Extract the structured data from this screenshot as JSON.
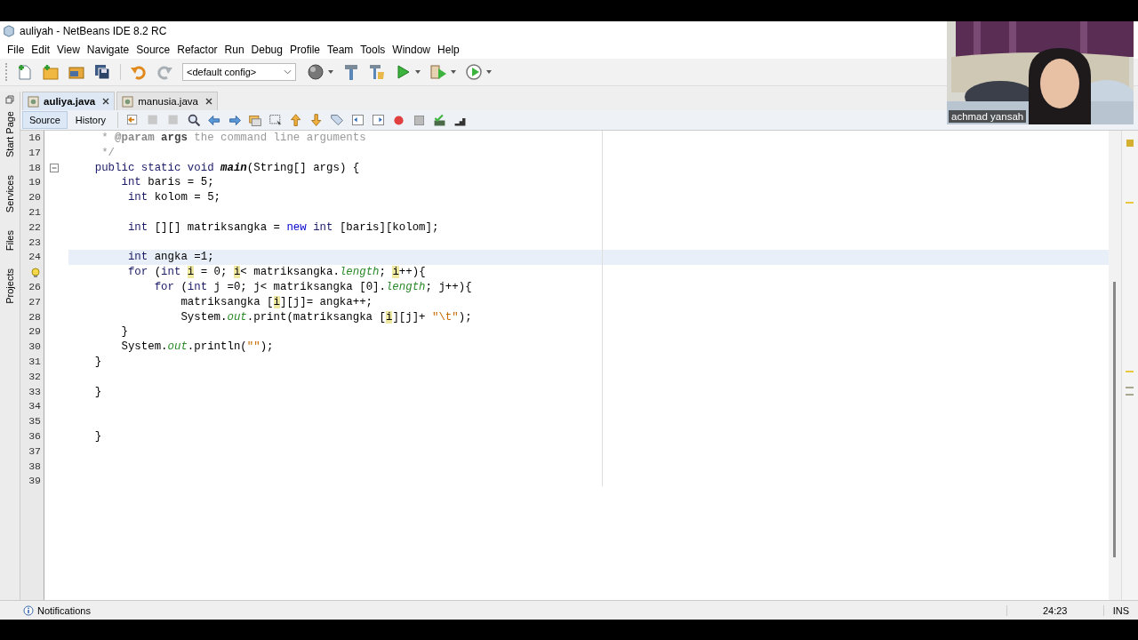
{
  "window": {
    "title": "auliyah - NetBeans IDE 8.2 RC"
  },
  "menu": [
    "File",
    "Edit",
    "View",
    "Navigate",
    "Source",
    "Refactor",
    "Run",
    "Debug",
    "Profile",
    "Team",
    "Tools",
    "Window",
    "Help"
  ],
  "toolbar": {
    "config": "<default config>"
  },
  "side_tabs": [
    "Start Page",
    "Services",
    "Files",
    "Projects"
  ],
  "tabs": [
    {
      "label": "auliya.java",
      "selected": true
    },
    {
      "label": "manusia.java",
      "selected": false
    }
  ],
  "view_tabs": [
    {
      "label": "Source",
      "selected": true
    },
    {
      "label": "History",
      "selected": false
    }
  ],
  "code": [
    {
      "number": "16",
      "current": false,
      "hint": false,
      "fold": false,
      "segments": [
        {
          "kind": "comment",
          "text": "     * "
        },
        {
          "kind": "comment-tag",
          "text": "@param"
        },
        {
          "kind": "comment-bold",
          "text": " args"
        },
        {
          "kind": "comment",
          "text": " the command line arguments"
        }
      ]
    },
    {
      "number": "17",
      "current": false,
      "hint": false,
      "fold": false,
      "segments": [
        {
          "kind": "comment",
          "text": "     */"
        }
      ]
    },
    {
      "number": "18",
      "current": false,
      "hint": false,
      "fold": true,
      "segments": [
        {
          "kind": "keyword",
          "text": "    public static void "
        },
        {
          "kind": "method",
          "text": "main"
        },
        {
          "kind": "plain",
          "text": "(String[] args) {"
        }
      ]
    },
    {
      "number": "19",
      "current": false,
      "hint": false,
      "fold": false,
      "segments": [
        {
          "kind": "keyword",
          "text": "        int"
        },
        {
          "kind": "plain",
          "text": " baris = 5;"
        }
      ]
    },
    {
      "number": "20",
      "current": false,
      "hint": false,
      "fold": false,
      "segments": [
        {
          "kind": "keyword",
          "text": "         int"
        },
        {
          "kind": "plain",
          "text": " kolom = 5;"
        }
      ]
    },
    {
      "number": "21",
      "current": false,
      "hint": false,
      "fold": false
    },
    {
      "number": "22",
      "current": false,
      "hint": false,
      "fold": false,
      "segments": [
        {
          "kind": "keyword",
          "text": "         int"
        },
        {
          "kind": "plain",
          "text": " [][] matriksangka = "
        },
        {
          "kind": "keyword-new",
          "text": "new "
        },
        {
          "kind": "keyword",
          "text": "int"
        },
        {
          "kind": "plain",
          "text": " [baris][kolom];"
        }
      ]
    },
    {
      "number": "23",
      "current": false,
      "hint": false,
      "fold": false
    },
    {
      "number": "24",
      "current": true,
      "hint": false,
      "fold": false,
      "segments": [
        {
          "kind": "keyword",
          "text": "         int"
        },
        {
          "kind": "plain",
          "text": " angka =1;"
        }
      ]
    },
    {
      "current": false,
      "hint": true,
      "fold": false,
      "segments": [
        {
          "kind": "keyword",
          "text": "         for"
        },
        {
          "kind": "plain",
          "text": " ("
        },
        {
          "kind": "keyword",
          "text": "int "
        },
        {
          "kind": "mark",
          "text": "i"
        },
        {
          "kind": "plain",
          "text": " = 0; "
        },
        {
          "kind": "mark",
          "text": "i"
        },
        {
          "kind": "plain",
          "text": "< matriksangka."
        },
        {
          "kind": "field",
          "text": "length"
        },
        {
          "kind": "plain",
          "text": "; "
        },
        {
          "kind": "mark",
          "text": "i"
        },
        {
          "kind": "plain",
          "text": "++){"
        }
      ]
    },
    {
      "number": "26",
      "current": false,
      "hint": false,
      "fold": false,
      "segments": [
        {
          "kind": "keyword",
          "text": "             for"
        },
        {
          "kind": "plain",
          "text": " ("
        },
        {
          "kind": "keyword",
          "text": "int"
        },
        {
          "kind": "plain",
          "text": " j =0; j< matriksangka [0]."
        },
        {
          "kind": "field",
          "text": "length"
        },
        {
          "kind": "plain",
          "text": "; j++){"
        }
      ]
    },
    {
      "number": "27",
      "current": false,
      "hint": false,
      "fold": false,
      "segments": [
        {
          "kind": "plain",
          "text": "                 matriksangka ["
        },
        {
          "kind": "mark",
          "text": "i"
        },
        {
          "kind": "plain",
          "text": "][j]= angka++;"
        }
      ]
    },
    {
      "number": "28",
      "current": false,
      "hint": false,
      "fold": false,
      "segments": [
        {
          "kind": "plain",
          "text": "                 System."
        },
        {
          "kind": "field",
          "text": "out"
        },
        {
          "kind": "plain",
          "text": ".print(matriksangka ["
        },
        {
          "kind": "mark",
          "text": "i"
        },
        {
          "kind": "plain",
          "text": "][j]+ "
        },
        {
          "kind": "string",
          "text": "\"\\t\""
        },
        {
          "kind": "plain",
          "text": ");"
        }
      ]
    },
    {
      "number": "29",
      "current": false,
      "hint": false,
      "fold": false,
      "segments": [
        {
          "kind": "plain",
          "text": "        }"
        }
      ]
    },
    {
      "number": "30",
      "current": false,
      "hint": false,
      "fold": false,
      "segments": [
        {
          "kind": "plain",
          "text": "        System."
        },
        {
          "kind": "field",
          "text": "out"
        },
        {
          "kind": "plain",
          "text": ".println("
        },
        {
          "kind": "string",
          "text": "\"\""
        },
        {
          "kind": "plain",
          "text": ");"
        }
      ]
    },
    {
      "number": "31",
      "current": false,
      "hint": false,
      "fold": false,
      "segments": [
        {
          "kind": "plain",
          "text": "    }"
        }
      ]
    },
    {
      "number": "32",
      "current": false,
      "hint": false,
      "fold": false
    },
    {
      "number": "33",
      "current": false,
      "hint": false,
      "fold": false,
      "segments": [
        {
          "kind": "plain",
          "text": "    }"
        }
      ]
    },
    {
      "number": "34",
      "current": false,
      "hint": false,
      "fold": false
    },
    {
      "number": "35",
      "current": false,
      "hint": false,
      "fold": false
    },
    {
      "number": "36",
      "current": false,
      "hint": false,
      "fold": false,
      "segments": [
        {
          "kind": "plain",
          "text": "    }"
        }
      ]
    },
    {
      "number": "37",
      "current": false,
      "hint": false,
      "fold": false
    },
    {
      "number": "38",
      "current": false,
      "hint": false,
      "fold": false
    },
    {
      "number": "39",
      "current": false,
      "hint": false,
      "fold": false
    }
  ],
  "status_bar": {
    "notifications": "Notifications",
    "position": "24:23",
    "mode": "INS"
  },
  "video": {
    "kind": "picture",
    "caption": "achmad yansah"
  }
}
